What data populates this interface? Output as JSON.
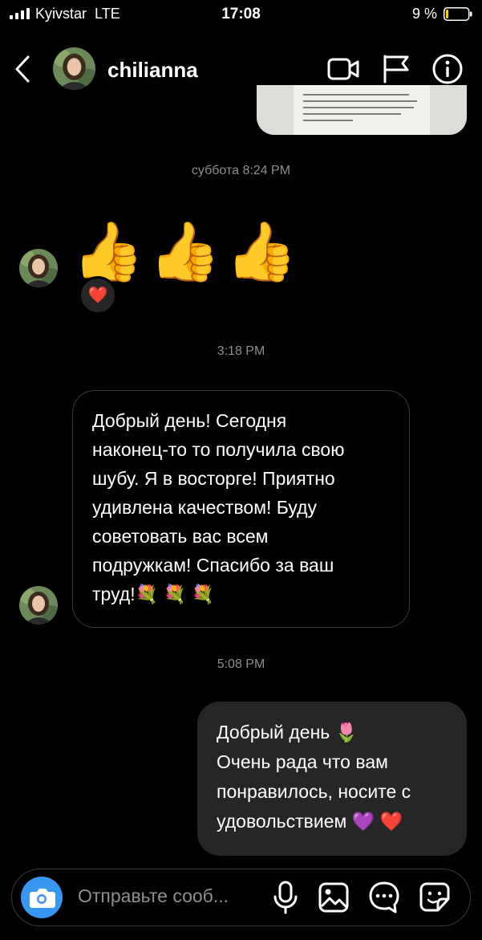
{
  "status": {
    "carrier": "Kyivstar",
    "network": "LTE",
    "time": "17:08",
    "battery": "9 %",
    "battery_level": 0.09
  },
  "header": {
    "username": "chilianna"
  },
  "thread": {
    "ts1": "суббота 8:24 PM",
    "emoji_thumbs": "👍👍👍",
    "reaction": "❤️",
    "ts2": "3:18 PM",
    "msg_in_lines": [
      "Добрый день! Сегодня",
      "наконец-то то получила свою",
      "шубу. Я в восторге! Приятно",
      "удивлена качеством! Буду",
      "советовать вас всем",
      "подружкам! Спасибо за ваш",
      "труд!💐 💐 💐"
    ],
    "ts3": "5:08 PM",
    "msg_out_lines": [
      "Добрый день 🌷",
      "Очень рада что вам",
      "понравилось, носите с",
      "удовольствием 💜 ❤️"
    ]
  },
  "composer": {
    "placeholder": "Отправьте сооб..."
  }
}
